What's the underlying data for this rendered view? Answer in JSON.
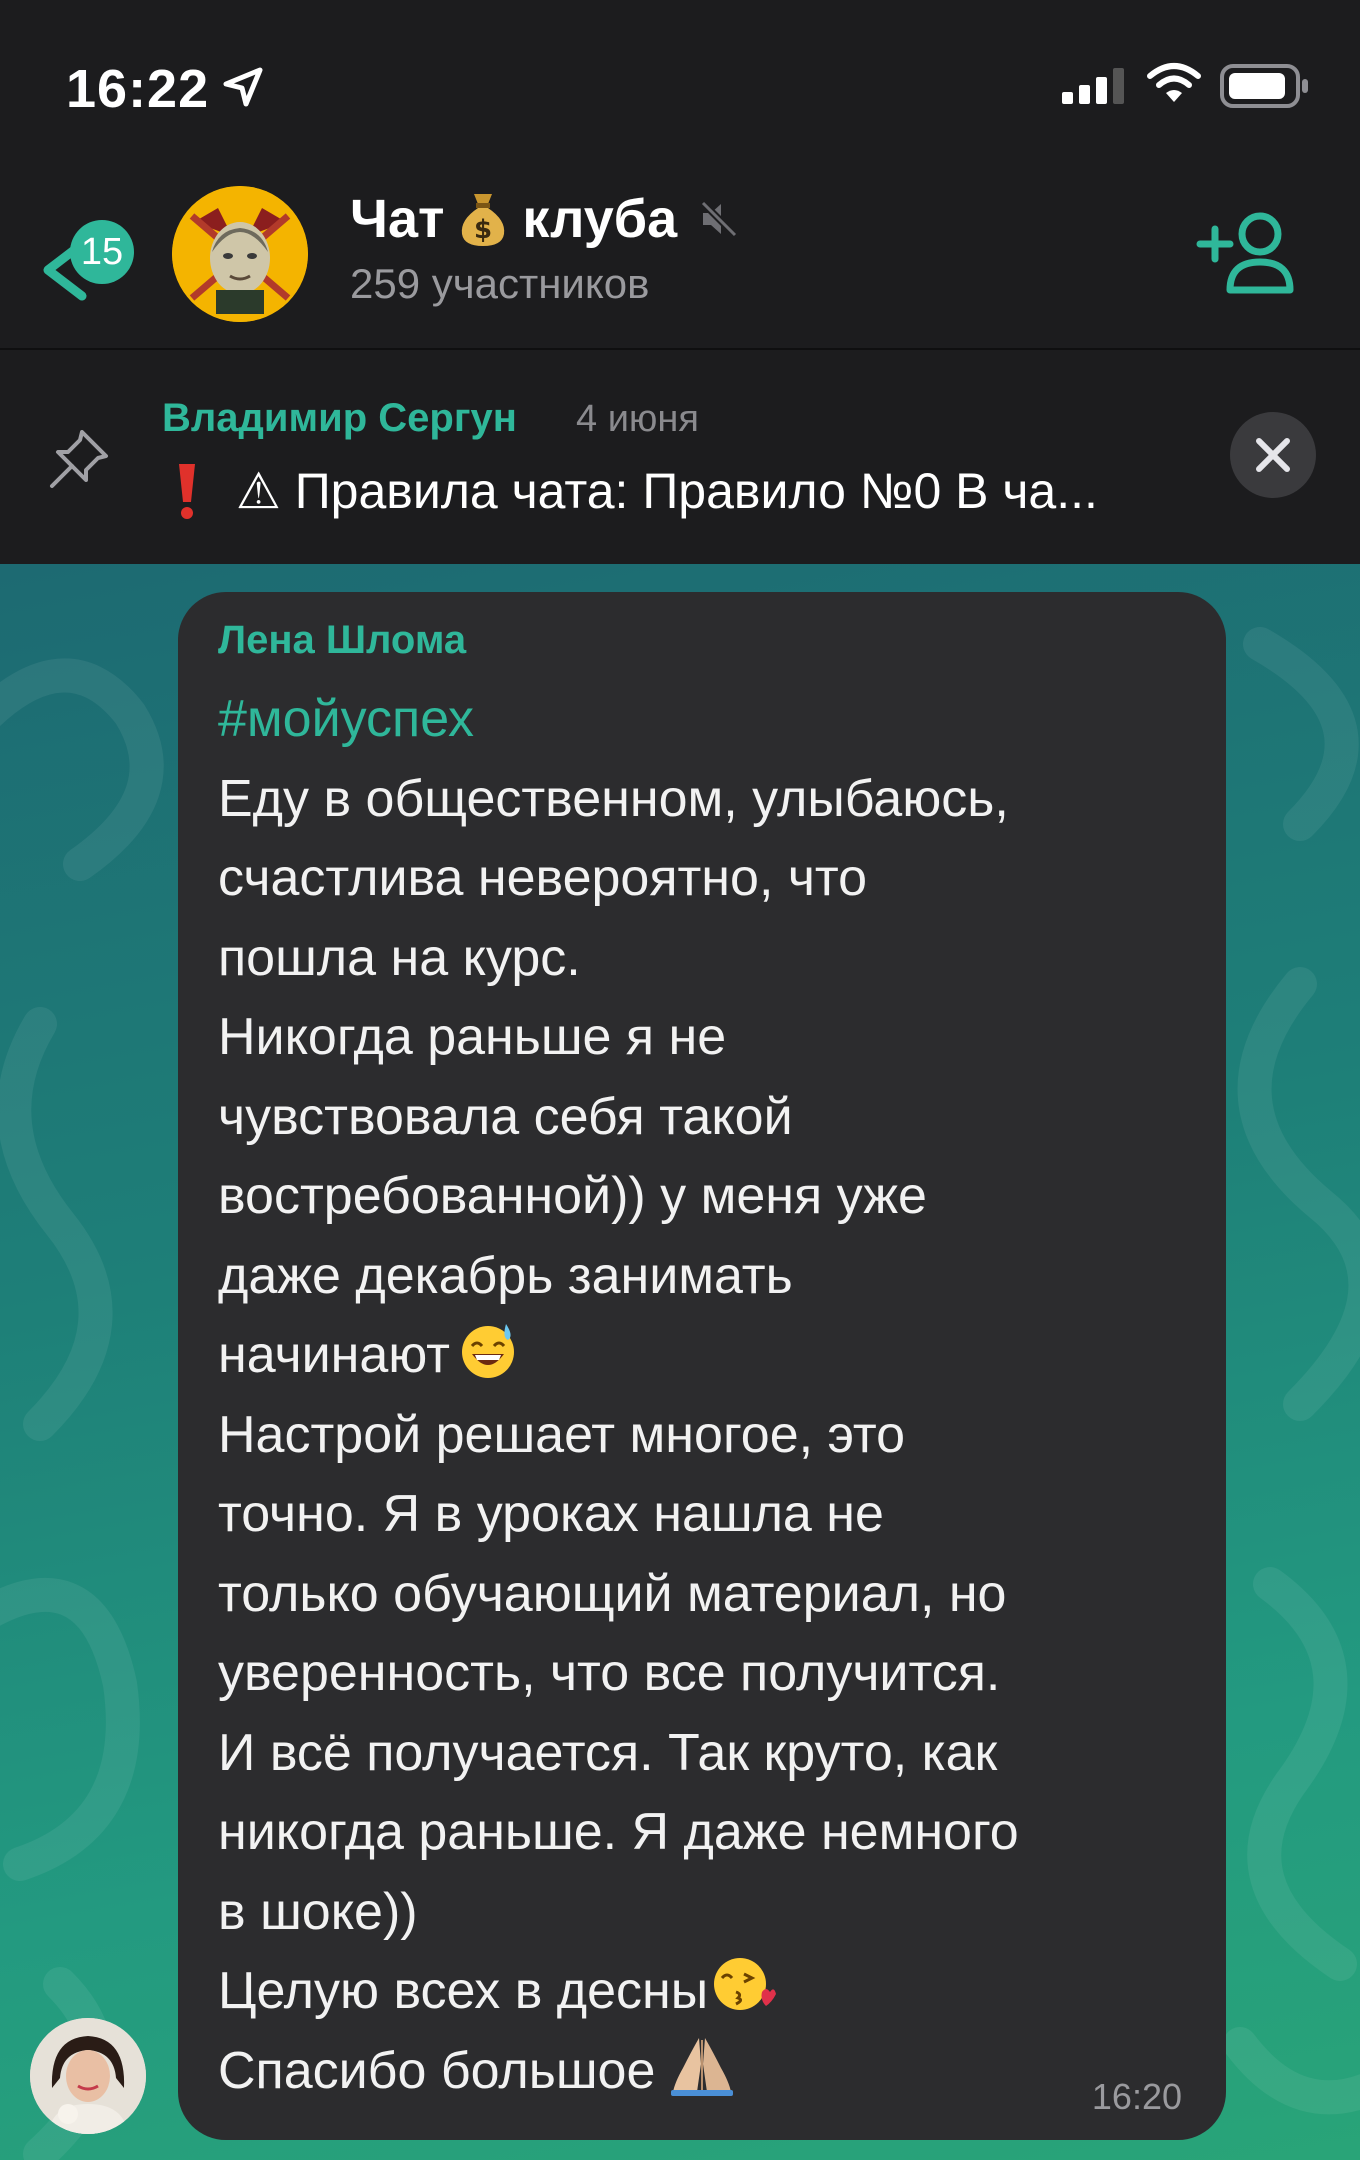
{
  "status_bar": {
    "time": "16:22"
  },
  "header": {
    "back_badge": "15",
    "title_part1": "Чат",
    "title_part2": "клуба",
    "subtitle": "259 участников"
  },
  "pinned": {
    "author": "Владимир Сергун",
    "date": "4 июня",
    "text": "⚠ Правила чата: Правило №0 В ча..."
  },
  "message": {
    "author": "Лена Шлома",
    "hashtag": "#мойуспех",
    "lines": [
      "Еду в общественном, улыбаюсь,",
      "счастлива невероятно, что",
      "пошла на курс.",
      "Никогда раньше я не",
      "чувствовала себя такой",
      "востребованной)) у меня уже",
      "даже декабрь занимать",
      "начинают",
      "Настрой решает многое, это",
      "точно. Я в уроках нашла не",
      "только обучающий материал, но",
      "уверенность, что все получится.",
      "И всё получается. Так круто, как",
      "никогда раньше. Я даже немного",
      "в шоке))",
      "Целую всех в десны",
      "Спасибо большое"
    ],
    "time": "16:20"
  },
  "colors": {
    "accent": "#2fb79a",
    "bubble": "#2c2c2e",
    "header_bg": "#1c1c1e"
  },
  "icons": [
    "location-arrow-icon",
    "signal-icon",
    "wifi-icon",
    "battery-icon",
    "back-chevron-icon",
    "money-bag-icon",
    "mute-icon",
    "add-member-icon",
    "pin-icon",
    "exclamation-icon",
    "close-icon",
    "sweat-smile-emoji",
    "kiss-emoji",
    "pray-emoji"
  ]
}
